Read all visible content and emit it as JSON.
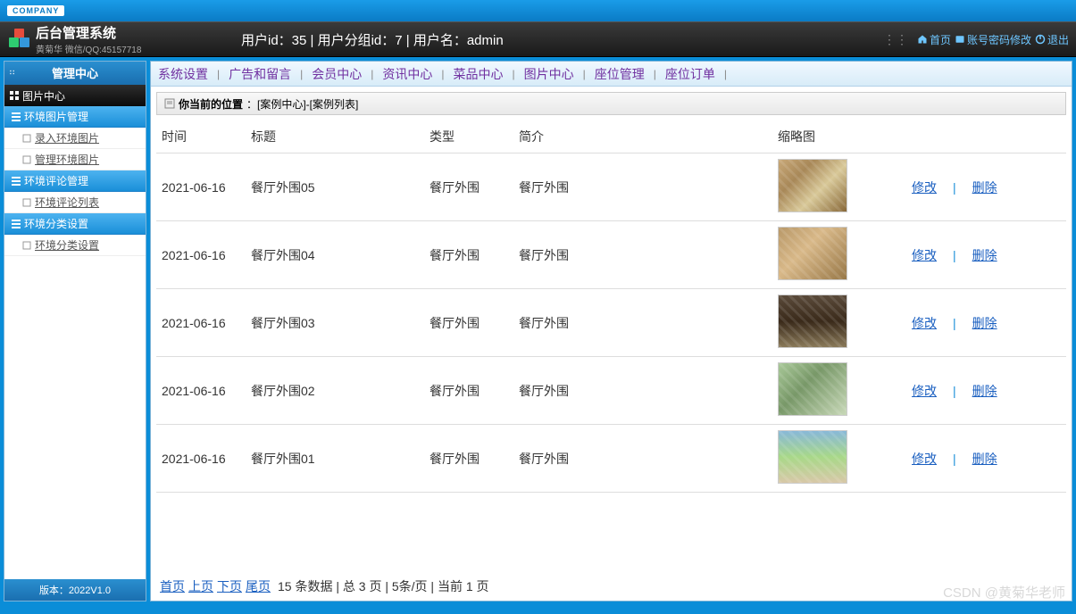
{
  "company_badge": "COMPANY",
  "logo": {
    "title": "后台管理系统",
    "sub": "黄菊华 微信/QQ:45157718"
  },
  "user_info": "用户id：35 | 用户分组id：7 | 用户名：admin",
  "header_buttons": {
    "home": "首页",
    "password": "账号密码修改",
    "logout": "退出"
  },
  "sidebar": {
    "head": "管理中心",
    "cat": "图片中心",
    "groups": [
      {
        "title": "环境图片管理",
        "items": [
          "录入环境图片",
          "管理环境图片"
        ]
      },
      {
        "title": "环境评论管理",
        "items": [
          "环境评论列表"
        ]
      },
      {
        "title": "环境分类设置",
        "items": [
          "环境分类设置"
        ]
      }
    ],
    "foot": "版本：2022V1.0"
  },
  "topnav": [
    "系统设置",
    "广告和留言",
    "会员中心",
    "资讯中心",
    "菜品中心",
    "图片中心",
    "座位管理",
    "座位订单"
  ],
  "breadcrumb": {
    "label": "你当前的位置",
    "path": "：[案例中心]-[案例列表]"
  },
  "columns": [
    "时间",
    "标题",
    "类型",
    "简介",
    "缩略图",
    ""
  ],
  "rows": [
    {
      "time": "2021-06-16",
      "title": "餐厅外围05",
      "type": "餐厅外围",
      "intro": "餐厅外围",
      "tclass": "t1"
    },
    {
      "time": "2021-06-16",
      "title": "餐厅外围04",
      "type": "餐厅外围",
      "intro": "餐厅外围",
      "tclass": "t2"
    },
    {
      "time": "2021-06-16",
      "title": "餐厅外围03",
      "type": "餐厅外围",
      "intro": "餐厅外围",
      "tclass": "t3"
    },
    {
      "time": "2021-06-16",
      "title": "餐厅外围02",
      "type": "餐厅外围",
      "intro": "餐厅外围",
      "tclass": "t4"
    },
    {
      "time": "2021-06-16",
      "title": "餐厅外围01",
      "type": "餐厅外围",
      "intro": "餐厅外围",
      "tclass": "t5"
    }
  ],
  "actions": {
    "edit": "修改",
    "delete": "删除"
  },
  "pager": {
    "first": "首页",
    "prev": "上页",
    "next": "下页",
    "last": "尾页",
    "info": "15 条数据 | 总 3 页 | 5条/页 | 当前 1 页"
  },
  "watermark": "CSDN @黄菊华老师"
}
